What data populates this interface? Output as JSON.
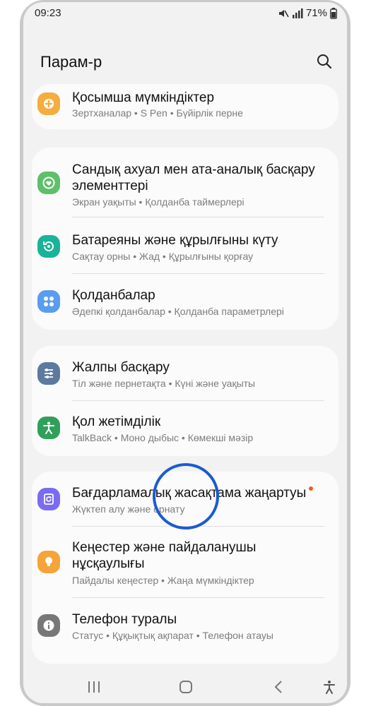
{
  "status_bar": {
    "time": "09:23",
    "battery": "71%"
  },
  "header": {
    "title": "Парам-р"
  },
  "groups": [
    {
      "items": [
        {
          "label": "Қосымша мүмкіндіктер",
          "sub": "Зертханалар • S Pen • Бүйірлік перне",
          "icon": "plus-gear-icon",
          "color": "#f5ad3d"
        }
      ]
    },
    {
      "items": [
        {
          "label": "Сандық ахуал мен ата-аналық басқару элементтері",
          "sub": "Экран уақыты • Қолданба таймерлері",
          "icon": "heart-circle-icon",
          "color": "#5fbf6a"
        },
        {
          "label": "Батареяны және құрылғыны күту",
          "sub": "Сақтау орны • Жад • Құрылғыны қорғау",
          "icon": "device-care-icon",
          "color": "#19b39a"
        },
        {
          "label": "Қолданбалар",
          "sub": "Әдепкі қолданбалар • Қолданба параметрлері",
          "icon": "apps-grid-icon",
          "color": "#5a9cf0"
        }
      ]
    },
    {
      "items": [
        {
          "label": "Жалпы басқару",
          "sub": "Тіл және пернетақта • Күні және уақыты",
          "icon": "sliders-icon",
          "color": "#5d7a9e"
        },
        {
          "label": "Қол жетімділік",
          "sub": "TalkBack • Моно дыбыс • Көмекші мәзір",
          "icon": "accessibility-person-icon",
          "color": "#2fa05a"
        }
      ]
    },
    {
      "items": [
        {
          "label": "Бағдарламалық жасақтама жаңартуы",
          "sub": "Жүктеп алу және орнату",
          "icon": "software-update-icon",
          "color": "#7a6cf0"
        },
        {
          "label": "Кеңестер және пайдаланушы нұсқаулығы",
          "sub": "Пайдалы кеңестер • Жаңа мүмкіндіктер",
          "icon": "lightbulb-icon",
          "color": "#f5a43a"
        },
        {
          "label": "Телефон туралы",
          "sub": "Статус • Құқықтық ақпарат • Телефон атауы",
          "icon": "info-icon",
          "color": "#777777"
        }
      ]
    }
  ],
  "nav_bar": {
    "recent": "recent-apps-icon",
    "home": "home-icon",
    "back": "back-icon",
    "accessibility": "accessibility-icon"
  }
}
